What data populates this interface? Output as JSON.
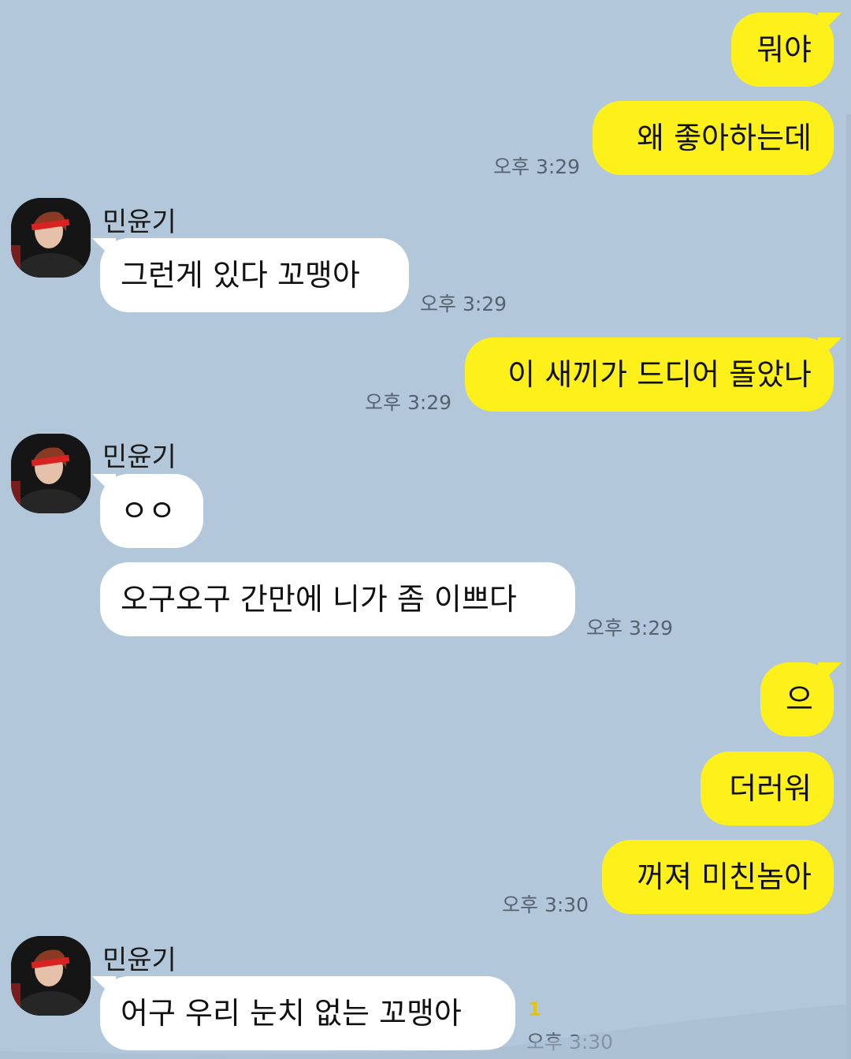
{
  "chat": {
    "time_329": "오후 3:29",
    "time_330": "오후 3:30",
    "sender_name": "민윤기",
    "unread_count": "1",
    "messages": {
      "m1": "뭐야",
      "m2": "왜 좋아하는데",
      "m3": "그런게 있다 꼬맹아",
      "m4": "이 새끼가 드디어 돌았나",
      "m5": "ㅇㅇ",
      "m6": "오구오구 간만에 니가 좀 이쁘다",
      "m7": "으",
      "m8": "더러워",
      "m9": "꺼져 미친놈아",
      "m10": "어구 우리 눈치 없는 꼬맹아"
    }
  },
  "colors": {
    "background": "#b2c7d9",
    "my_bubble": "#fef01b",
    "their_bubble": "#ffffff",
    "timestamp": "#556270",
    "unread": "#e8c400"
  },
  "icons": {
    "avatar": "profile-photo"
  }
}
